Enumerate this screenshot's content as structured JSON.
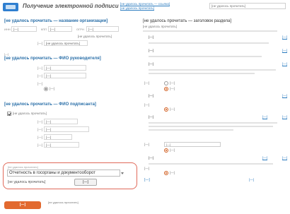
{
  "header": {
    "app_title": "Получение электронной подписи",
    "top_link_1": "[не удалось прочитать — ссылка]",
    "top_link_2": "[не удалось прочитать]",
    "top_select": "[не удалось прочитать]"
  },
  "organization": {
    "name": "[не удалось прочитать — название организации]",
    "inn_label": "ИНН",
    "inn_value": "[—]",
    "kpp_label": "КПП",
    "kpp_value": "[—]",
    "ogrn_label": "ОГРН",
    "ogrn_value": "[—]",
    "region_text": "[не удалось прочитать]",
    "address_label": "[—]",
    "address_value": "[не удалось прочитать]"
  },
  "director": {
    "section_label": "[—]",
    "name": "[не удалось прочитать — ФИО руководителя]",
    "phone_label": "[—]",
    "phone_value": "[—]",
    "email_label": "[—]",
    "email_value": "[—]",
    "sign_label": "[—]",
    "sign_option": "[—]"
  },
  "signer": {
    "name": "[не удалось прочитать — ФИО подписанта]",
    "checkbox_label": "[не удалось прочитать]",
    "field_1_label": "[—]",
    "field_1_value": "[—]",
    "field_2_label": "[—]",
    "field_2_value": "[—]",
    "field_3_label": "[—]",
    "field_3_value": "[—]",
    "field_4_label": "[—]",
    "field_4_value": "[—]"
  },
  "reporting": {
    "title": "[не удалось прочитать]",
    "selected_option": "Отчетность в госорганы и документооборот",
    "direction_label": "[не удалось прочитать]",
    "change_button": "[—]"
  },
  "documents": {
    "title": "[не удалось прочитать — заголовок раздела]",
    "intro": "[не удалось прочитать]",
    "steps": [
      {
        "text": "[—]",
        "link": "[—]"
      },
      {
        "text": "[—]",
        "link": "[—]"
      },
      {
        "text": "[—]",
        "link": "[—]"
      },
      {
        "text": "[—]",
        "link": "[—]"
      },
      {
        "text": "[—]",
        "link": "[—]",
        "link2": "[—]"
      },
      {
        "text": "[—]",
        "link": "[—]",
        "link2": "[—]"
      }
    ],
    "sig_label_1": "[—]",
    "sig_option_1": "[—]",
    "sig_option_2": "[—]",
    "sig_label_2": "[—]",
    "sig_radio_1": "[—]",
    "sig_label_3": "[—]",
    "sig_select": "[—]",
    "sig_radio_2": "[—]",
    "sig_label_4": "[—]",
    "sig_radio_3": "[—]",
    "protect_link": "[—]",
    "protect_link_2": "[—]"
  },
  "footer": {
    "submit_button": "[—]",
    "note": "[не удалось прочитать]"
  },
  "colors": {
    "accent_blue": "#2a6fa8",
    "link_blue": "#2a7bbf",
    "button_orange": "#e2692f",
    "highlight_red": "#e06a5a"
  }
}
